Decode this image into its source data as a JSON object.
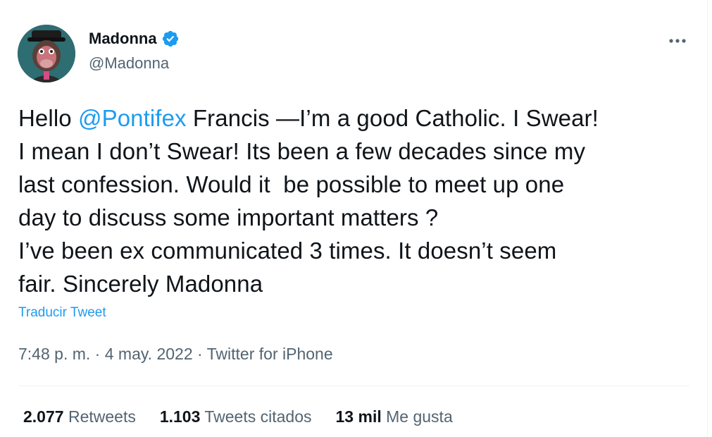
{
  "author": {
    "name": "Madonna",
    "handle": "@Madonna"
  },
  "tweet": {
    "lines": [
      {
        "before": "Hello ",
        "mention": "@Pontifex",
        "after": " Francis —I’m a good Catholic. I Swear!"
      },
      "I mean I don’t Swear! Its been a few decades since my",
      "last confession. Would it  be possible to meet up one",
      "day to discuss some important matters ?",
      "I’ve been ex communicated 3 times. It doesn’t seem",
      "fair. Sincerely Madonna"
    ]
  },
  "translate_label": "Traducir Tweet",
  "meta": {
    "time": "7:48 p. m.",
    "sep1": " · ",
    "date": "4 may. 2022",
    "sep2": " · ",
    "source": "Twitter for iPhone"
  },
  "stats": {
    "retweets": {
      "count": "2.077",
      "label": "Retweets"
    },
    "quotes": {
      "count": "1.103",
      "label": "Tweets citados"
    },
    "likes": {
      "count": "13 mil",
      "label": "Me gusta"
    }
  },
  "icons": {
    "verified": "verified-badge-icon",
    "more": "more-options-icon"
  },
  "colors": {
    "accent": "#1d9bf0",
    "text": "#0f1419",
    "secondary": "#536471"
  }
}
